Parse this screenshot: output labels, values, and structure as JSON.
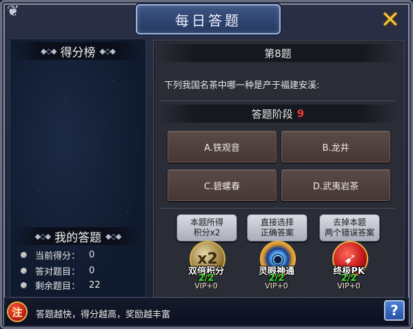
{
  "window": {
    "title": "每日答题",
    "accent_color": "#3d5584"
  },
  "left": {
    "leaderboard_title": "得分榜",
    "my_answers_title": "我的答题",
    "stats": [
      {
        "label": "当前得分：",
        "value": "0"
      },
      {
        "label": "答对题目：",
        "value": "0"
      },
      {
        "label": "剩余题目：",
        "value": "22"
      }
    ]
  },
  "question": {
    "number_label": "第8题",
    "text": "下列我国名茶中哪一种是产于福建安溪:",
    "phase_label": "答题阶段",
    "countdown": "9",
    "countdown_color": "#e83a3a"
  },
  "answers": [
    {
      "label": "A.铁观音"
    },
    {
      "label": "B.龙井"
    },
    {
      "label": "C.碧螺春"
    },
    {
      "label": "D.武夷岩茶"
    }
  ],
  "tools": [
    {
      "desc_line1": "本题所得",
      "desc_line2": "积分x2",
      "name": "双倍积分",
      "count": "2/2",
      "vip": "VIP+0",
      "icon": "double-points-icon",
      "icon_glyph": "x2"
    },
    {
      "desc_line1": "直接选择",
      "desc_line2": "正确答案",
      "name": "灵眼神通",
      "count": "2/2",
      "vip": "VIP+0",
      "icon": "eye-icon",
      "icon_glyph": "◉"
    },
    {
      "desc_line1": "去掉本题",
      "desc_line2": "两个错误答案",
      "name": "终极PK",
      "count": "2/2",
      "vip": "VIP+0",
      "icon": "pk-icon",
      "icon_glyph": "➹"
    }
  ],
  "bottom": {
    "note_badge": "注",
    "tip": "答题越快，得分越高，奖励越丰富",
    "help_label": "?"
  }
}
